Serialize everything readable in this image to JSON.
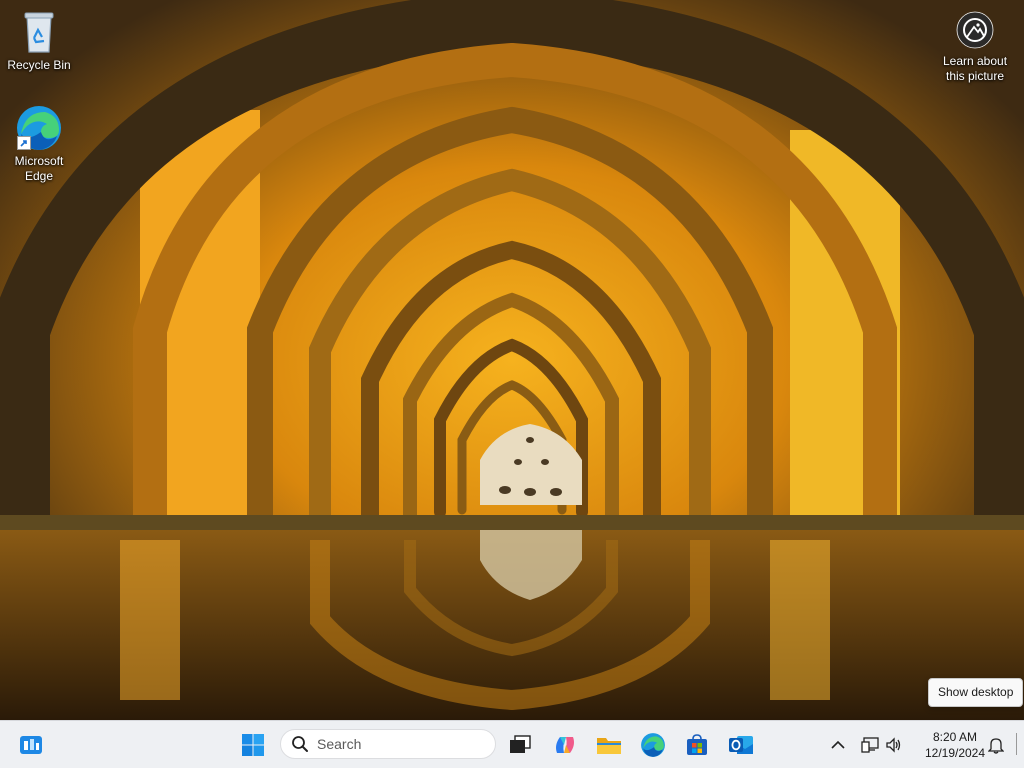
{
  "desktop": {
    "icons": [
      {
        "label": "Recycle Bin",
        "icon": "recycle-bin-icon"
      },
      {
        "label": "Microsoft Edge",
        "icon": "edge-icon"
      }
    ],
    "spotlight": {
      "label": "Learn about this picture",
      "icon": "camera-spotlight-icon"
    }
  },
  "tooltip": {
    "text": "Show desktop"
  },
  "taskbar": {
    "search_placeholder": "Search",
    "apps": [
      {
        "name": "Widgets",
        "icon": "widgets-icon"
      },
      {
        "name": "Start",
        "icon": "windows-start-icon"
      },
      {
        "name": "Task View",
        "icon": "task-view-icon"
      },
      {
        "name": "Copilot",
        "icon": "copilot-icon"
      },
      {
        "name": "File Explorer",
        "icon": "file-explorer-icon"
      },
      {
        "name": "Microsoft Edge",
        "icon": "edge-icon"
      },
      {
        "name": "Microsoft Store",
        "icon": "store-icon"
      },
      {
        "name": "Outlook",
        "icon": "outlook-icon"
      }
    ],
    "tray": {
      "time": "8:20 AM",
      "date": "12/19/2024",
      "icons": [
        "chevron-up-icon",
        "network-icon",
        "volume-icon",
        "notification-bell-icon"
      ]
    }
  },
  "colors": {
    "taskbar_bg": "#eef0f3",
    "accent": "#0078d4"
  }
}
